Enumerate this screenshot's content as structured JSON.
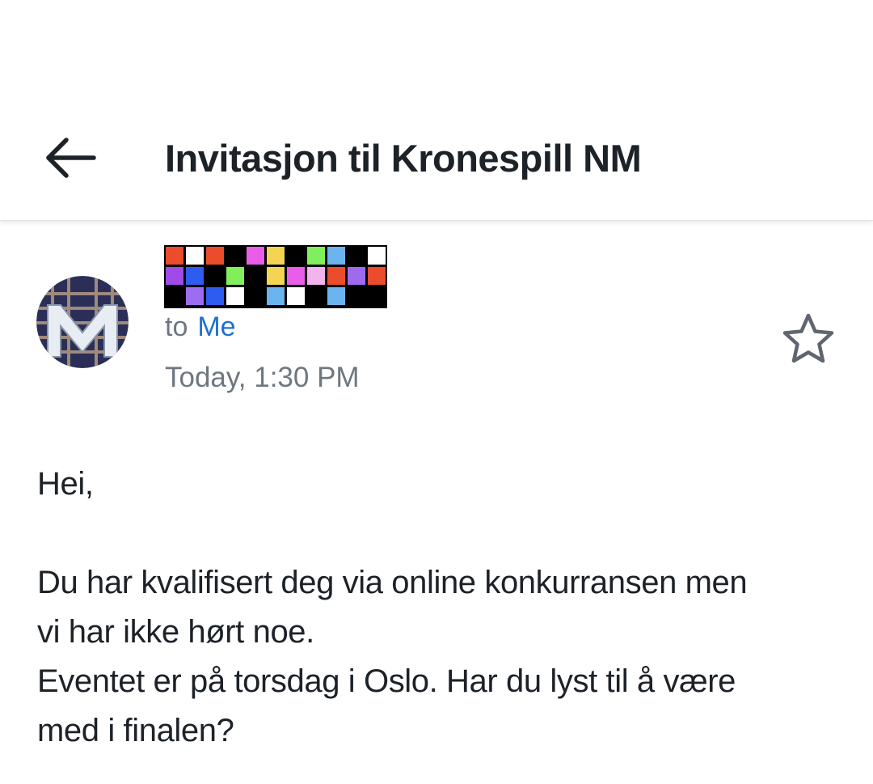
{
  "header": {
    "title": "Invitasjon til Kronespill NM",
    "back_icon": "arrow-left-icon"
  },
  "message": {
    "avatar_letter": "M",
    "to_label": "to",
    "to_name": "Me",
    "date": "Today, 1:30 PM",
    "star_icon": "star-outline-icon",
    "body": {
      "greeting": "Hei,",
      "line1": "Du har kvalifisert deg via online konkurransen men",
      "line2": "vi har ikke hørt noe.",
      "line3": "Eventet er på torsdag i Oslo. Har du lyst til å være",
      "line4": "med i finalen?"
    }
  },
  "colors": {
    "title_text": "#1d2228",
    "secondary_text": "#6e7780",
    "link_blue": "#1f6fd1",
    "background": "#ffffff"
  }
}
